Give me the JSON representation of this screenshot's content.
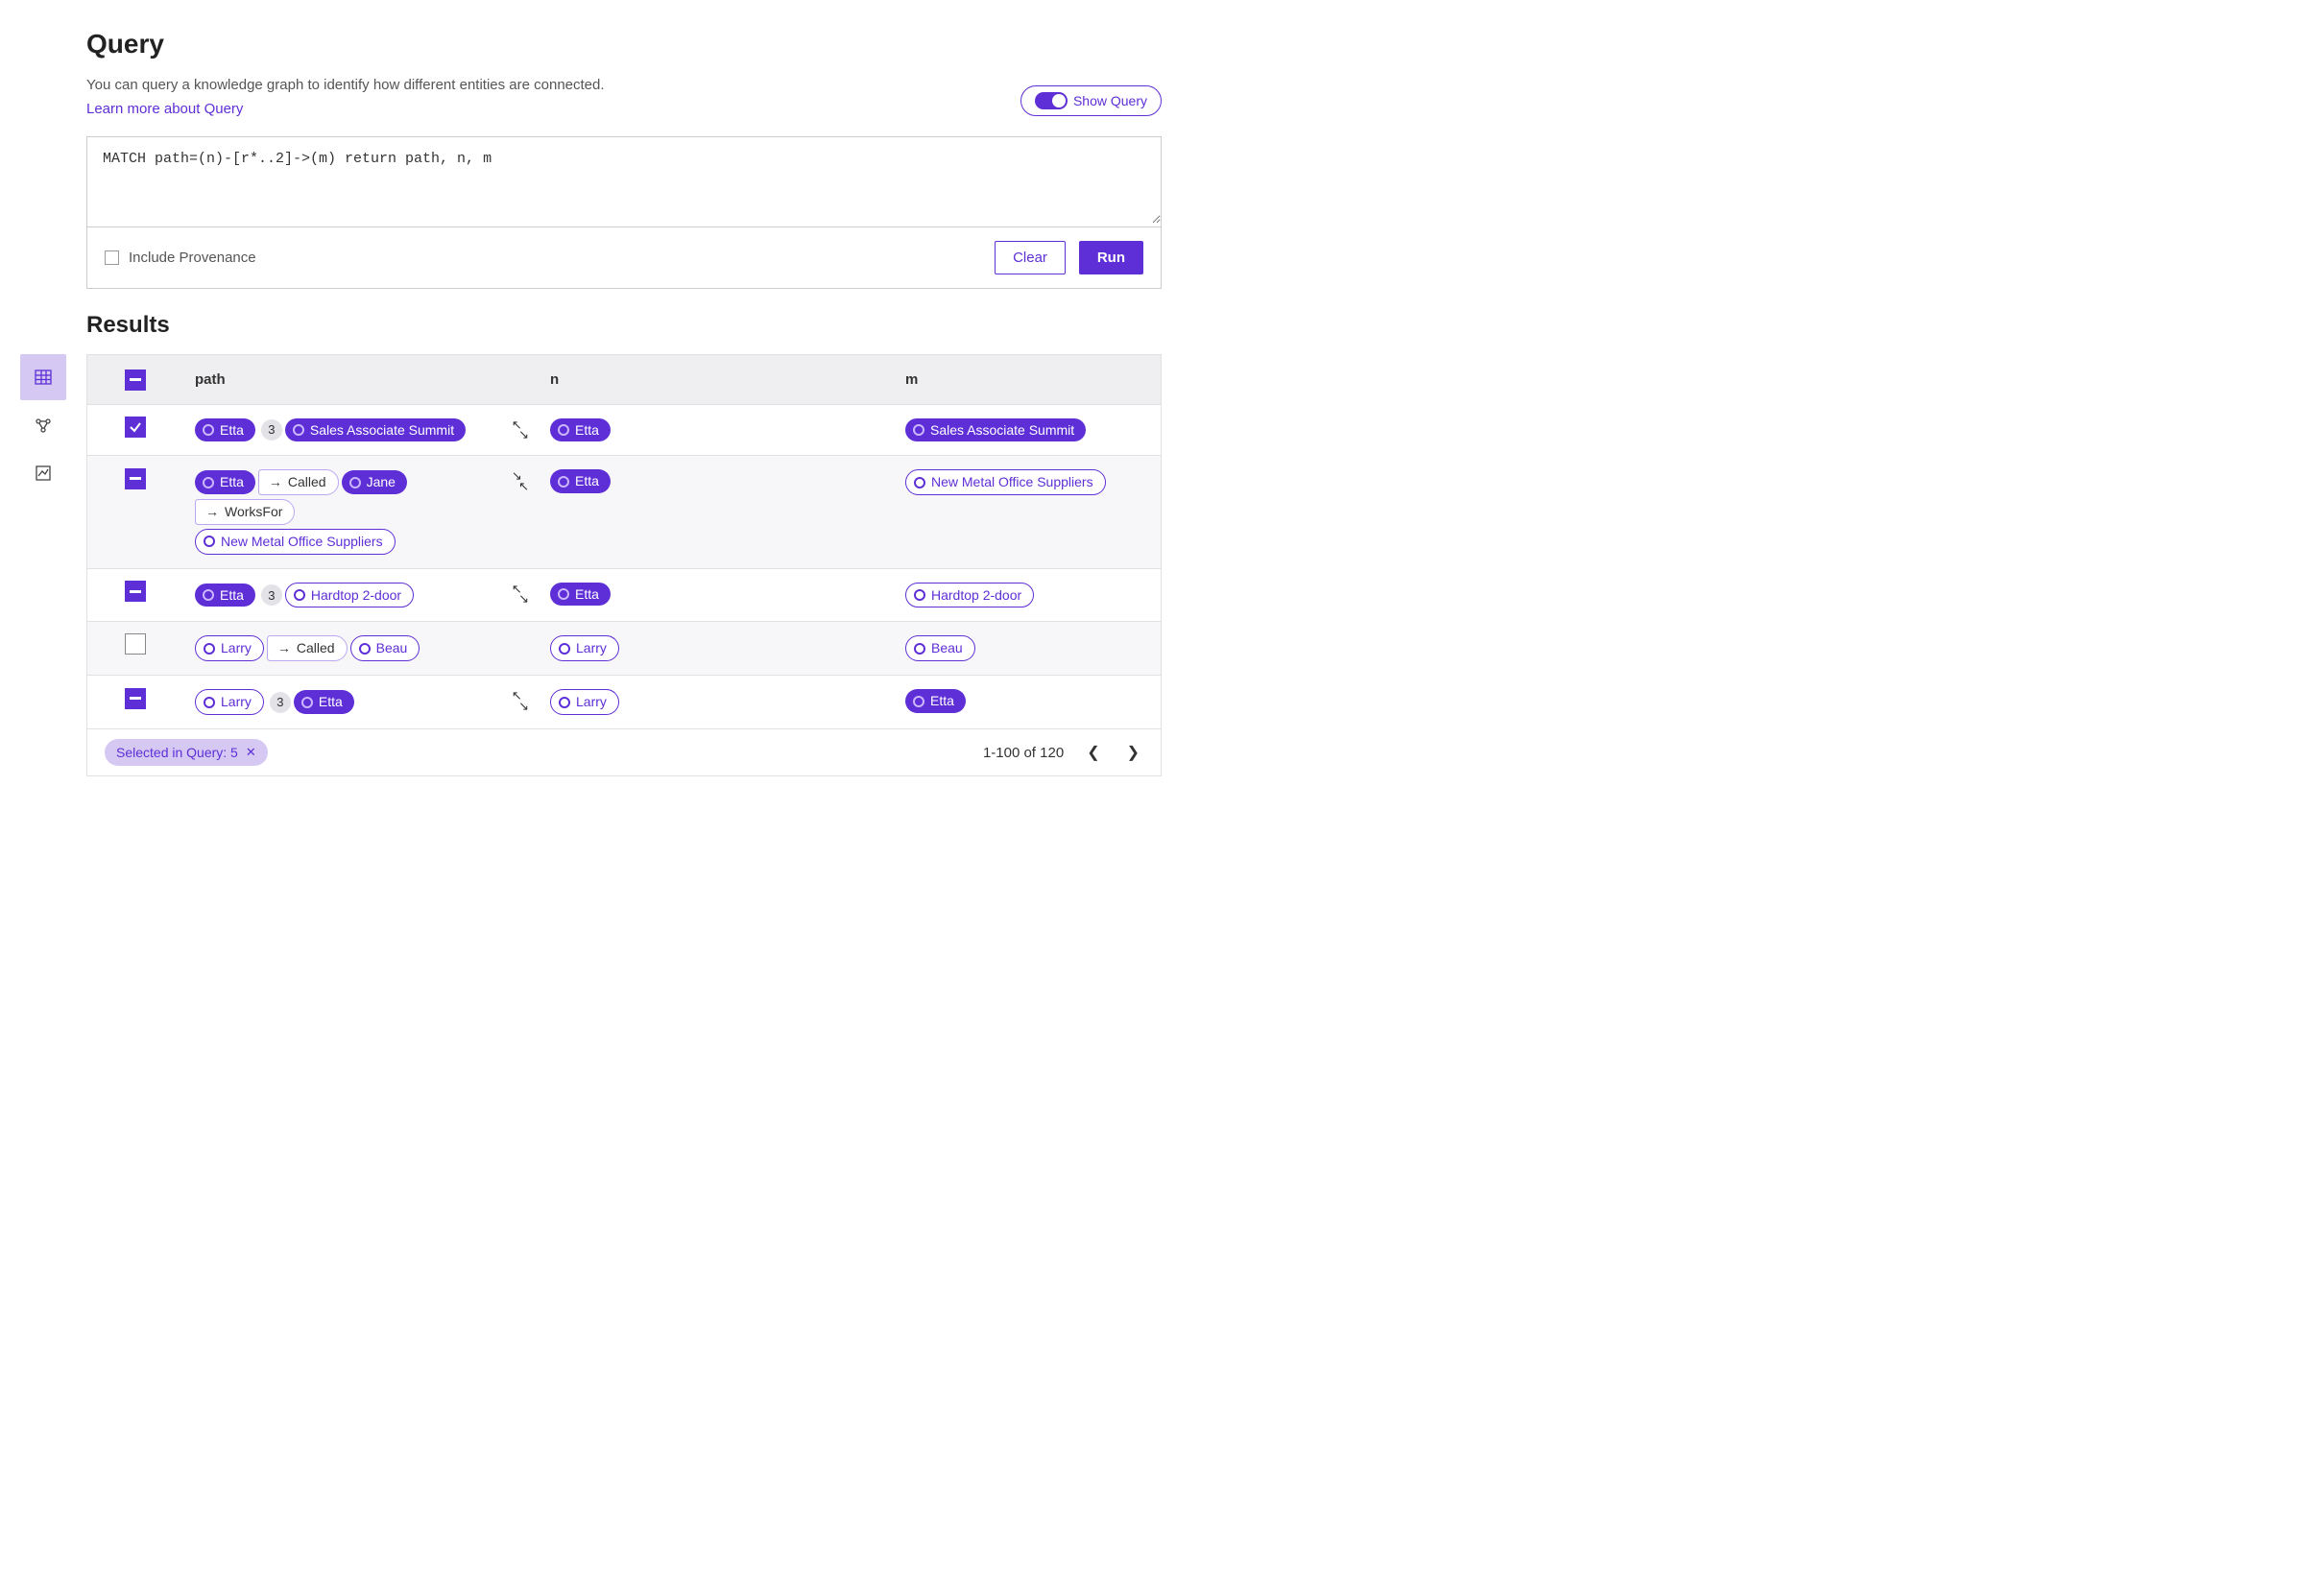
{
  "header": {
    "title": "Query",
    "subtitle": "You can query a knowledge graph to identify how different entities are connected.",
    "learn_more": "Learn more about Query",
    "show_query": "Show Query"
  },
  "queryBox": {
    "text": "MATCH path=(n)-[r*..2]->(m) return path, n, m",
    "include_provenance": "Include Provenance",
    "clear": "Clear",
    "run": "Run"
  },
  "results": {
    "heading": "Results",
    "columns": {
      "path": "path",
      "n": "n",
      "m": "m"
    },
    "rows": [
      {
        "state": "checked",
        "path": [
          {
            "type": "node-solid",
            "label": "Etta"
          },
          {
            "type": "count",
            "label": "3"
          },
          {
            "type": "node-solid",
            "label": "Sales Associate Summit"
          }
        ],
        "expand": "out",
        "n": [
          {
            "type": "node-solid",
            "label": "Etta"
          }
        ],
        "m": [
          {
            "type": "node-solid",
            "label": "Sales Associate Summit"
          }
        ]
      },
      {
        "state": "partial",
        "path": [
          {
            "type": "node-solid",
            "label": "Etta"
          },
          {
            "type": "rel",
            "label": "Called"
          },
          {
            "type": "node-solid",
            "label": "Jane"
          },
          {
            "type": "rel",
            "label": "WorksFor"
          },
          {
            "type": "node-outline",
            "label": "New Metal Office Suppliers"
          }
        ],
        "expand": "in",
        "n": [
          {
            "type": "node-solid",
            "label": "Etta"
          }
        ],
        "m": [
          {
            "type": "node-outline",
            "label": "New Metal Office Suppliers"
          }
        ]
      },
      {
        "state": "partial",
        "path": [
          {
            "type": "node-solid",
            "label": "Etta"
          },
          {
            "type": "count",
            "label": "3"
          },
          {
            "type": "node-outline",
            "label": "Hardtop 2-door"
          }
        ],
        "expand": "out",
        "n": [
          {
            "type": "node-solid",
            "label": "Etta"
          }
        ],
        "m": [
          {
            "type": "node-outline",
            "label": "Hardtop 2-door"
          }
        ]
      },
      {
        "state": "unchecked",
        "path": [
          {
            "type": "node-outline",
            "label": "Larry"
          },
          {
            "type": "rel",
            "label": "Called"
          },
          {
            "type": "node-outline",
            "label": "Beau"
          }
        ],
        "expand": "",
        "n": [
          {
            "type": "node-outline",
            "label": "Larry"
          }
        ],
        "m": [
          {
            "type": "node-outline",
            "label": "Beau"
          }
        ]
      },
      {
        "state": "partial",
        "path": [
          {
            "type": "node-outline",
            "label": "Larry"
          },
          {
            "type": "count",
            "label": "3"
          },
          {
            "type": "node-solid",
            "label": "Etta"
          }
        ],
        "expand": "out",
        "n": [
          {
            "type": "node-outline",
            "label": "Larry"
          }
        ],
        "m": [
          {
            "type": "node-solid",
            "label": "Etta"
          }
        ]
      }
    ],
    "footer": {
      "selected_label": "Selected in Query: 5",
      "range_label": "1-100 of 120"
    }
  }
}
